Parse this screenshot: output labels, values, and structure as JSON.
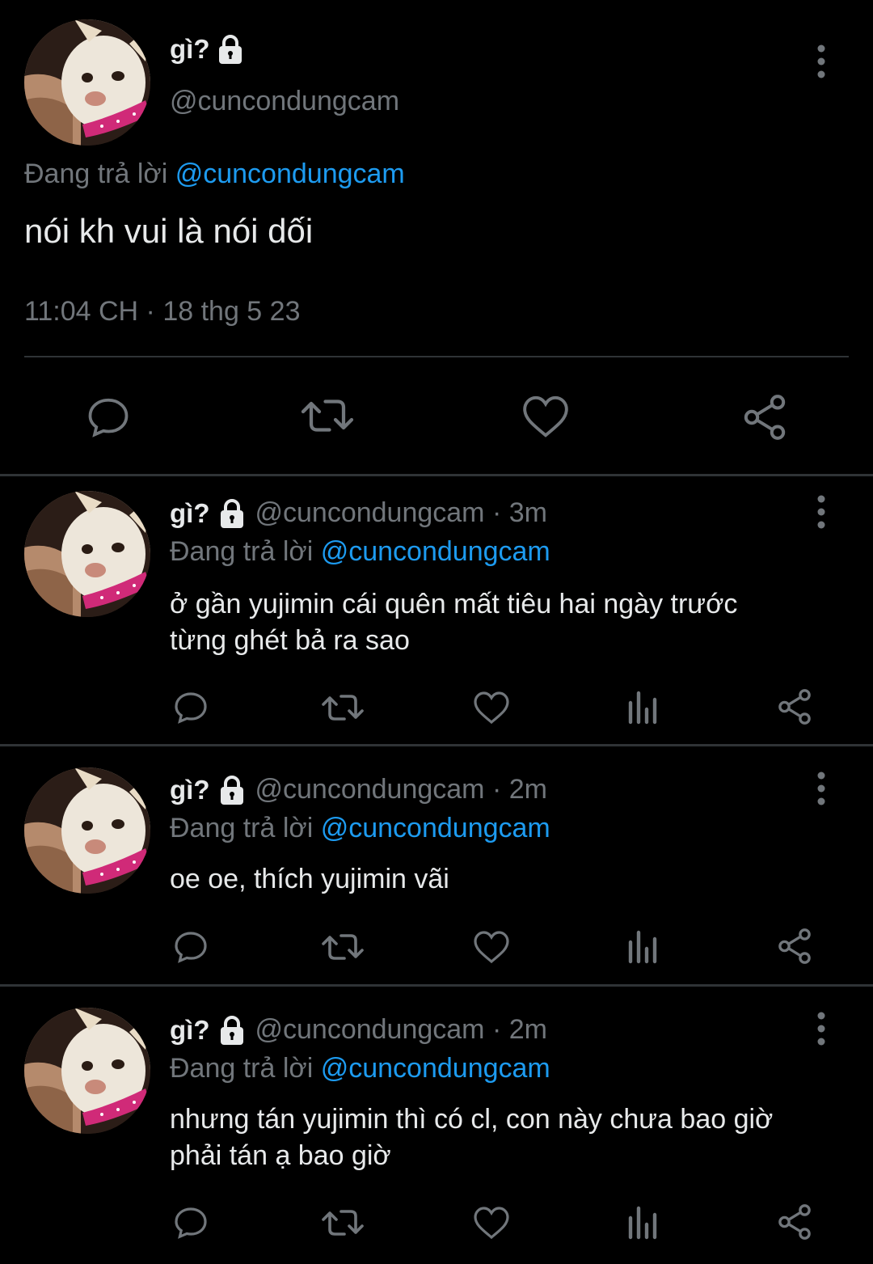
{
  "main_tweet": {
    "display_name": "gì?",
    "handle": "@cuncondungcam",
    "replying_prefix": "Đang trả lời",
    "replying_to": "@cuncondungcam",
    "text": "nói kh vui là nói dối",
    "timestamp": "11:04 CH · 18 thg 5 23",
    "actions": [
      "reply-icon",
      "retweet-icon",
      "like-icon",
      "share-icon"
    ]
  },
  "replies": [
    {
      "display_name": "gì?",
      "handle_time": "@cuncondungcam · 3m",
      "replying_prefix": "Đang trả lời",
      "replying_to": "@cuncondungcam",
      "text_line1": "ở gần yujimin cái quên mất tiêu hai ngày trước",
      "text_line2": "từng ghét bả ra sao"
    },
    {
      "display_name": "gì?",
      "handle_time": "@cuncondungcam · 2m",
      "replying_prefix": "Đang trả lời",
      "replying_to": "@cuncondungcam",
      "text_line1": "oe oe, thích yujimin vãi",
      "text_line2": ""
    },
    {
      "display_name": "gì?",
      "handle_time": "@cuncondungcam · 2m",
      "replying_prefix": "Đang trả lời",
      "replying_to": "@cuncondungcam",
      "text_line1": "nhưng tán yujimin thì có cl, con này chưa bao giờ",
      "text_line2": "phải tán ạ bao giờ"
    }
  ],
  "colors": {
    "background": "#000000",
    "text": "#e7e9ea",
    "secondary": "#71767b",
    "link": "#1d9bf0",
    "divider": "#2f3336"
  }
}
